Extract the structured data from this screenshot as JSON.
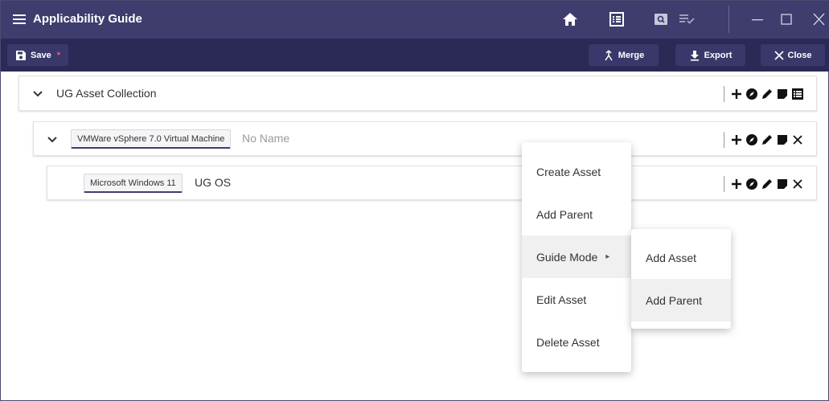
{
  "window": {
    "title": "Applicability Guide"
  },
  "toolbar": {
    "save_label": "Save",
    "unsaved_marker": "*",
    "merge_label": "Merge",
    "export_label": "Export",
    "close_label": "Close"
  },
  "tree": {
    "root": {
      "label": "UG Asset Collection"
    },
    "vm": {
      "type": "VMWare vSphere 7.0 Virtual Machine",
      "name": "No Name"
    },
    "os": {
      "type": "Microsoft Windows 11",
      "name": "UG OS"
    }
  },
  "context_menu": {
    "items": [
      {
        "label": "Create Asset"
      },
      {
        "label": "Add Parent"
      },
      {
        "label": "Guide Mode",
        "has_submenu": true,
        "submenu_arrow": "▸"
      },
      {
        "label": "Edit Asset"
      },
      {
        "label": "Delete Asset"
      }
    ],
    "highlighted": "Guide Mode"
  },
  "submenu": {
    "items": [
      {
        "label": "Add Asset"
      },
      {
        "label": "Add Parent"
      }
    ],
    "highlighted": "Add Parent"
  },
  "colors": {
    "titlebar": "#3f3d6e",
    "toolbar": "#2b2956",
    "unsaved_marker": "#ff5c5c",
    "highlight": "#f0f0f0"
  },
  "icons": {
    "titlebar": [
      "hamburger-icon",
      "home-icon",
      "list-box-icon",
      "search-box-icon",
      "checklist-icon"
    ],
    "window": [
      "minimize-icon",
      "maximize-icon",
      "close-icon"
    ],
    "row_actions": [
      "plus-icon",
      "compass-icon",
      "pencil-icon",
      "note-icon",
      "list-icon",
      "close-icon"
    ]
  }
}
